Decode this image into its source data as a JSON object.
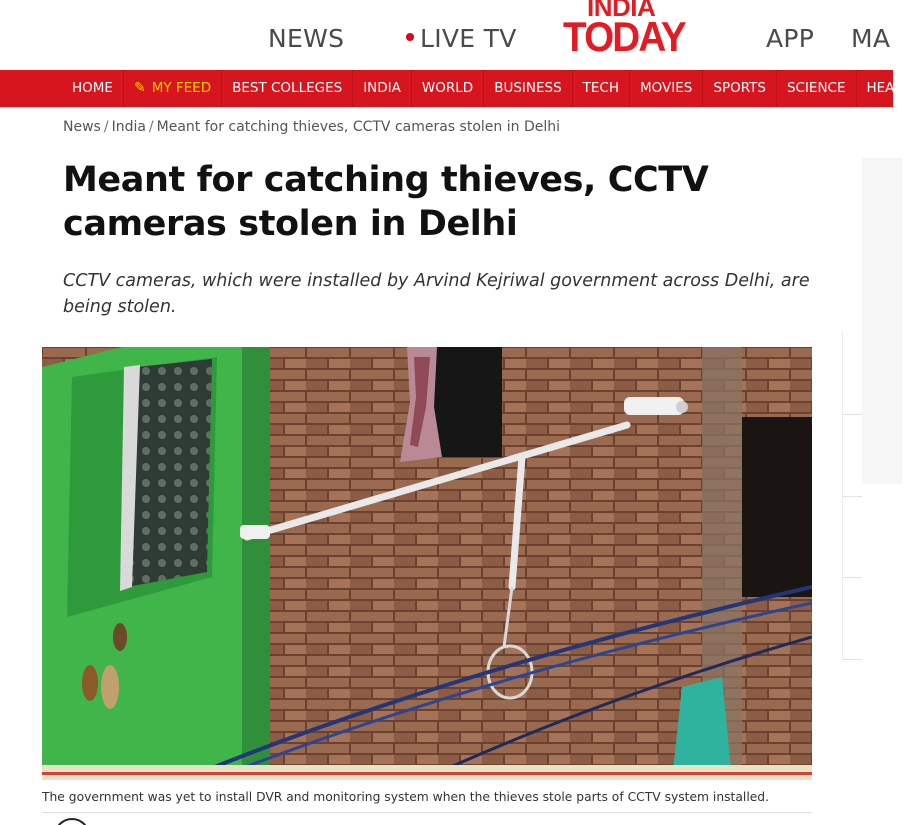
{
  "header": {
    "nav_items": [
      "NEWS",
      "LIVE TV",
      "APP",
      "MA"
    ],
    "logo_top": "INDIA",
    "logo_bottom": "TODAY",
    "brand_color": "#e31b23"
  },
  "rednav": {
    "items": [
      "HOME",
      "MY FEED",
      "BEST COLLEGES",
      "INDIA",
      "WORLD",
      "BUSINESS",
      "TECH",
      "MOVIES",
      "SPORTS",
      "SCIENCE",
      "HEALTH"
    ],
    "bg_color": "#d7151e",
    "highlight_color": "#ffd200"
  },
  "breadcrumb": {
    "items": [
      "News",
      "India",
      "Meant for catching thieves, CCTV cameras stolen in Delhi"
    ],
    "separator": "/"
  },
  "article": {
    "headline": "Meant for catching thieves, CCTV cameras stolen in Delhi",
    "summary": "CCTV cameras, which were installed by Arvind Kejriwal government across Delhi, are being stolen.",
    "image_caption": "The government was yet to install DVR and monitoring system when the thieves stole parts of CCTV system installed."
  }
}
